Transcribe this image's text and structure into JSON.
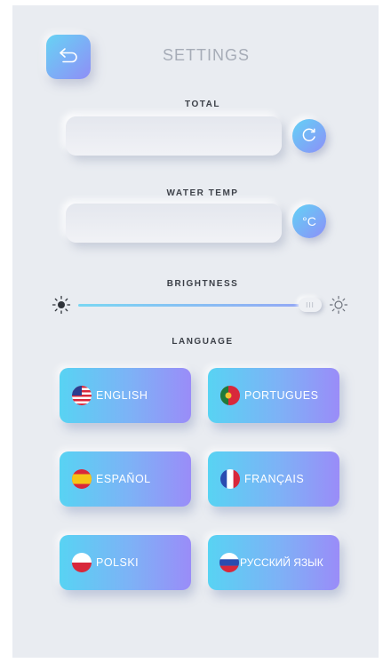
{
  "header": {
    "title": "SETTINGS",
    "back_icon": "back-arrow-icon"
  },
  "total": {
    "label": "TOTAL",
    "value": "",
    "button_icon": "reset-icon"
  },
  "water_temp": {
    "label": "WATER TEMP",
    "value": "",
    "button_label": "°C"
  },
  "brightness": {
    "label": "BRIGHTNESS",
    "level": 1.0,
    "min_icon": "sun-dim-icon",
    "max_icon": "sun-bright-icon",
    "thumb_label": "III"
  },
  "language": {
    "label": "LANGUAGE",
    "options": [
      {
        "label": "ENGLISH",
        "flag": "us-flag-icon"
      },
      {
        "label": "PORTUGUES",
        "flag": "portugal-flag-icon"
      },
      {
        "label": "ESPAÑOL",
        "flag": "spain-flag-icon"
      },
      {
        "label": "FRANÇAIS",
        "flag": "france-flag-icon"
      },
      {
        "label": "POLSKI",
        "flag": "poland-flag-icon"
      },
      {
        "label": "РУССКИЙ ЯЗЫК",
        "flag": "russia-flag-icon"
      }
    ]
  },
  "colors": {
    "accent_start": "#5ad3f3",
    "accent_end": "#9a8cf8",
    "background": "#e9ecf1",
    "title_text": "#a6acb7",
    "label_text": "#3b3f47"
  }
}
